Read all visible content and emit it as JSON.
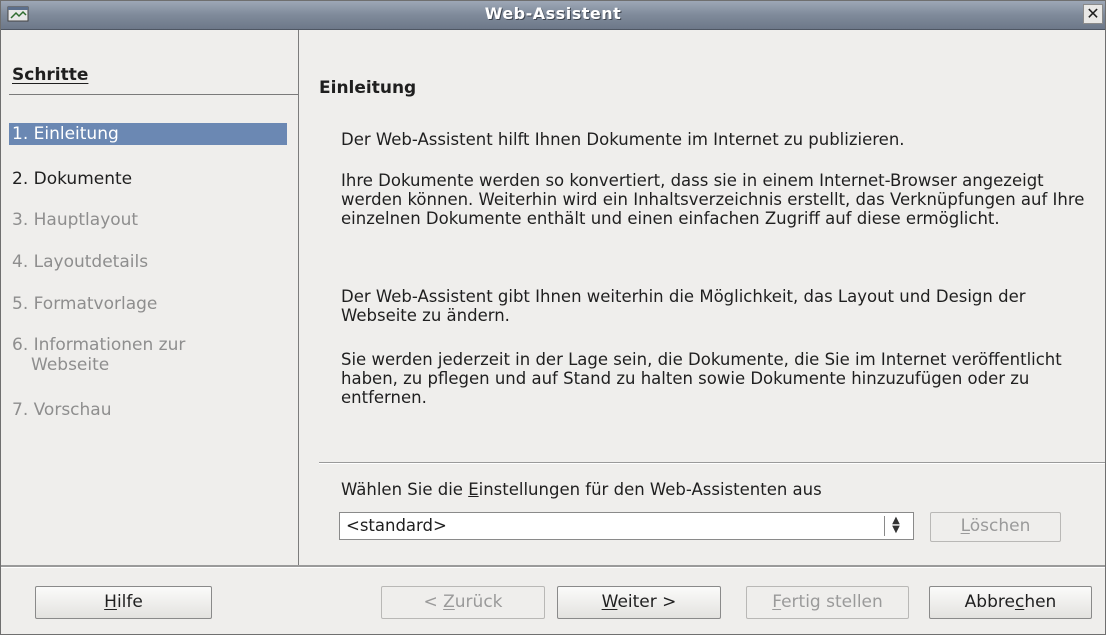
{
  "window": {
    "title": "Web-Assistent",
    "close_label": "✕"
  },
  "steps": {
    "heading": "Schritte",
    "items": [
      {
        "label": "1. Einleitung",
        "state": "active"
      },
      {
        "label": "2. Dokumente",
        "state": "enabled"
      },
      {
        "label": "3. Hauptlayout",
        "state": "disabled"
      },
      {
        "label": "4. Layoutdetails",
        "state": "disabled"
      },
      {
        "label": "5. Formatvorlage",
        "state": "disabled"
      },
      {
        "label_line1": "6. Informationen zur",
        "label_line2": "Webseite",
        "state": "disabled"
      },
      {
        "label": "7. Vorschau",
        "state": "disabled"
      }
    ]
  },
  "main": {
    "title": "Einleitung",
    "paragraphs": [
      "Der Web-Assistent hilft Ihnen Dokumente im Internet zu publizieren.",
      "Ihre Dokumente werden so konvertiert, dass sie in einem Internet-Browser angezeigt werden können. Weiterhin wird ein Inhaltsverzeichnis erstellt, das Verknüpfungen auf Ihre einzelnen Dokumente enthält und einen einfachen Zugriff auf diese ermöglicht.",
      "Der Web-Assistent gibt Ihnen weiterhin die Möglichkeit, das Layout und Design der Webseite zu ändern.",
      "Sie werden jederzeit in der Lage sein, die Dokumente, die Sie im Internet veröffentlicht haben, zu pflegen und auf Stand zu halten sowie Dokumente hinzuzufügen oder zu entfernen."
    ],
    "settings_label_pre": "Wählen Sie die ",
    "settings_label_mnemonic": "E",
    "settings_label_post": "instellungen für den Web-Assistenten aus",
    "settings_value": "<standard>",
    "delete_mnemonic": "L",
    "delete_rest": "öschen"
  },
  "buttons": {
    "help_mnemonic": "H",
    "help_rest": "ilfe",
    "back_pre": "< ",
    "back_mnemonic": "Z",
    "back_rest": "urück",
    "next_mnemonic": "W",
    "next_rest": "eiter >",
    "finish_mnemonic": "F",
    "finish_rest": "ertig stellen",
    "cancel_pre": "Abbre",
    "cancel_mnemonic": "c",
    "cancel_rest": "hen"
  }
}
